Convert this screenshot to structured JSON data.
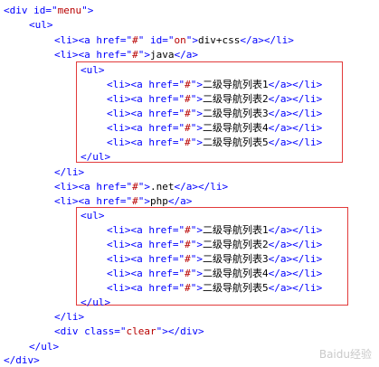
{
  "colors": {
    "tag": "#0000ff",
    "attr_value": "#b80000",
    "text": "#000000",
    "highlight_border": "#e23a3a"
  },
  "code": {
    "l1": {
      "a": "<div id=\"",
      "b": "menu",
      "c": "\">"
    },
    "l2": {
      "a": "<ul>"
    },
    "l3": {
      "a": "<li><a href=\"",
      "b": "#",
      "c": "\" id=\"",
      "d": "on",
      "e": "\">",
      "f": "div+css",
      "g": "</a></li>"
    },
    "l4": {
      "a": "<li><a href=\"",
      "b": "#",
      "c": "\">",
      "d": "java",
      "e": "</a>"
    },
    "l5": {
      "a": "<ul>"
    },
    "l6": {
      "a": "<li><a href=\"",
      "b": "#",
      "c": "\">",
      "d": "二级导航列表1",
      "e": "</a></li>"
    },
    "l7": {
      "a": "<li><a href=\"",
      "b": "#",
      "c": "\">",
      "d": "二级导航列表2",
      "e": "</a></li>"
    },
    "l8": {
      "a": "<li><a href=\"",
      "b": "#",
      "c": "\">",
      "d": "二级导航列表3",
      "e": "</a></li>"
    },
    "l9": {
      "a": "<li><a href=\"",
      "b": "#",
      "c": "\">",
      "d": "二级导航列表4",
      "e": "</a></li>"
    },
    "l10": {
      "a": "<li><a href=\"",
      "b": "#",
      "c": "\">",
      "d": "二级导航列表5",
      "e": "</a></li>"
    },
    "l11": {
      "a": "</ul>"
    },
    "l12": {
      "a": "</li>"
    },
    "l13": {
      "a": "<li><a href=\"",
      "b": "#",
      "c": "\">",
      "d": ".net",
      "e": "</a></li>"
    },
    "l14": {
      "a": "<li><a href=\"",
      "b": "#",
      "c": "\">",
      "d": "php",
      "e": "</a>"
    },
    "l15": {
      "a": "<ul>"
    },
    "l16": {
      "a": "<li><a href=\"",
      "b": "#",
      "c": "\">",
      "d": "二级导航列表1",
      "e": "</a></li>"
    },
    "l17": {
      "a": "<li><a href=\"",
      "b": "#",
      "c": "\">",
      "d": "二级导航列表2",
      "e": "</a></li>"
    },
    "l18": {
      "a": "<li><a href=\"",
      "b": "#",
      "c": "\">",
      "d": "二级导航列表3",
      "e": "</a></li>"
    },
    "l19": {
      "a": "<li><a href=\"",
      "b": "#",
      "c": "\">",
      "d": "二级导航列表4",
      "e": "</a></li>"
    },
    "l20": {
      "a": "<li><a href=\"",
      "b": "#",
      "c": "\">",
      "d": "二级导航列表5",
      "e": "</a></li>"
    },
    "l21": {
      "a": "</ul>"
    },
    "l22": {
      "a": "</li>"
    },
    "l23": {
      "a": "<div class=\"",
      "b": "clear",
      "c": "\"></div>"
    },
    "l24": {
      "a": "</ul>"
    },
    "l25": {
      "a": "</div>"
    }
  },
  "watermark": "Baidu经验"
}
